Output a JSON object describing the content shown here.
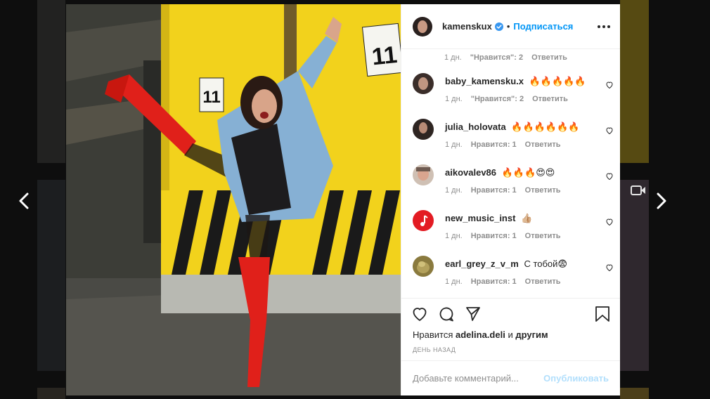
{
  "post": {
    "username": "kamenskux",
    "separator": "•",
    "follow_label": "Подписаться",
    "previous_comment_meta": {
      "time": "1 дн.",
      "likes": "\"Нравится\": 2",
      "reply": "Ответить"
    }
  },
  "comments": [
    {
      "user": "baby_kamensku.x",
      "text": "🔥🔥🔥🔥🔥",
      "time": "1 дн.",
      "likes": "\"Нравится\": 2",
      "reply": "Ответить",
      "avatar_color": "#3b2e2a"
    },
    {
      "user": "julia_holovata",
      "text": "🔥🔥🔥🔥🔥🔥",
      "time": "1 дн.",
      "likes": "Нравится: 1",
      "reply": "Ответить",
      "avatar_color": "#2e2522"
    },
    {
      "user": "aikovalev86",
      "text": "🔥🔥🔥😍😍",
      "time": "1 дн.",
      "likes": "Нравится: 1",
      "reply": "Ответить",
      "avatar_color": "#b89a8a"
    },
    {
      "user": "new_music_inst",
      "text": "👍🏼",
      "time": "1 дн.",
      "likes": "Нравится: 1",
      "reply": "Ответить",
      "avatar_color": "#e31b23"
    },
    {
      "user": "earl_grey_z_v_m",
      "text": "С тобой😨",
      "time": "1 дн.",
      "likes": "Нравится: 1",
      "reply": "Ответить",
      "avatar_color": "#8a7a3e"
    }
  ],
  "likes_line": {
    "prefix": "Нравится",
    "user": "adelina.deli",
    "connector": "и",
    "others": "другим"
  },
  "timestamp": "ДЕНЬ НАЗАД",
  "add_comment": {
    "placeholder": "Добавьте комментарий...",
    "publish_label": "Опубликовать"
  },
  "photo": {
    "sign_number_left": "11",
    "sign_number_right": "11"
  },
  "colors": {
    "accent": "#0095f6",
    "publish_disabled": "#b2dffc",
    "wall_yellow": "#f2d21c",
    "boots_red": "#e0201a"
  }
}
